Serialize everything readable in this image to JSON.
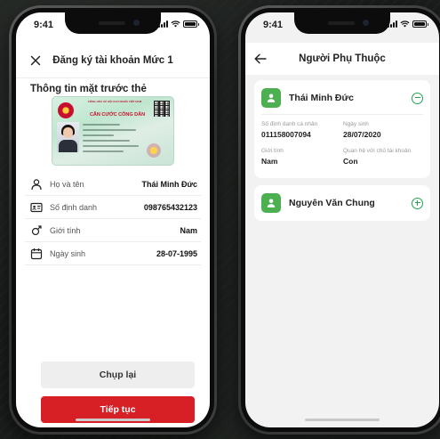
{
  "left": {
    "status_time": "9:41",
    "header_title": "Đăng ký tài khoản Mức 1",
    "section_title": "Thông tin mặt trước thẻ",
    "id_card": {
      "header": "CỘNG HÒA XÃ HỘI CHỦ NGHĨA VIỆT NAM",
      "title": "CĂN CƯỚC CÔNG DÂN"
    },
    "fields": [
      {
        "icon": "person-icon",
        "label": "Họ và tên",
        "value": "Thái Minh Đức"
      },
      {
        "icon": "id-card-icon",
        "label": "Số định danh",
        "value": "098765432123"
      },
      {
        "icon": "gender-icon",
        "label": "Giới tính",
        "value": "Nam"
      },
      {
        "icon": "calendar-icon",
        "label": "Ngày sinh",
        "value": "28-07-1995"
      }
    ],
    "retake_label": "Chụp lại",
    "continue_label": "Tiếp tục"
  },
  "right": {
    "status_time": "9:41",
    "header_title": "Người Phụ Thuộc",
    "dependents": [
      {
        "name": "Thái Minh Đức",
        "expanded": true,
        "id_label": "Số định danh cá nhân",
        "id_value": "011158007094",
        "dob_label": "Ngày sinh",
        "dob_value": "28/07/2020",
        "gender_label": "Giới tính",
        "gender_value": "Nam",
        "relation_label": "Quan hệ với chủ tài khoản",
        "relation_value": "Con"
      },
      {
        "name": "Nguyên Văn Chung",
        "expanded": false
      }
    ]
  },
  "colors": {
    "brand_red": "#d71f26",
    "accent_green": "#4caf50",
    "toggle_green": "#1fa54f"
  }
}
